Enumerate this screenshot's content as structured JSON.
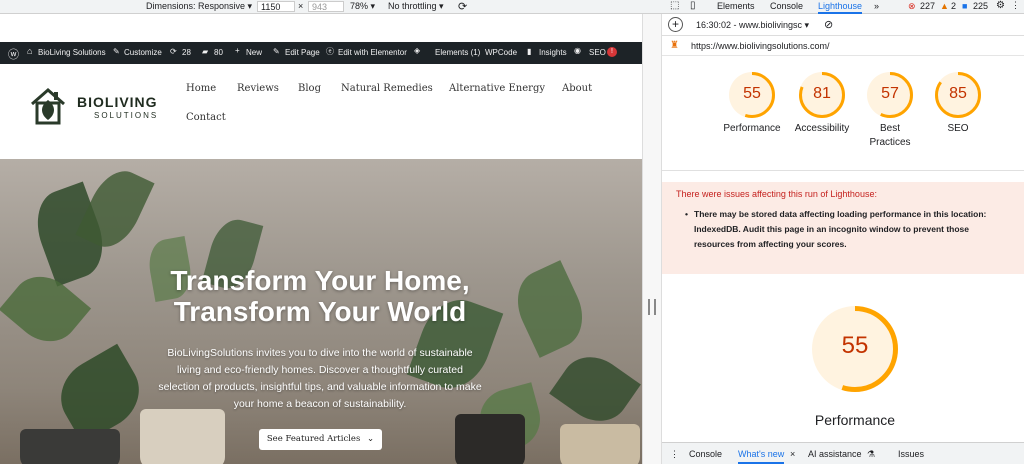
{
  "devtools_toolbar": {
    "dimensions_label": "Dimensions: Responsive ▾",
    "width": "1150",
    "times": "×",
    "height": "943",
    "zoom": "78% ▾",
    "throttling": "No throttling ▾"
  },
  "devtools_tabs": {
    "elements": "Elements",
    "console": "Console",
    "lighthouse": "Lighthouse",
    "more": "»",
    "errors": "227",
    "warnings": "2",
    "issues": "225"
  },
  "wp_admin_bar": {
    "site": "BioLiving Solutions",
    "customize": "Customize",
    "updates": "28",
    "comments": "80",
    "new": "New",
    "edit_page": "Edit Page",
    "elementor": "Edit with Elementor",
    "elements": "Elements (1)",
    "wpcode": "WPCode",
    "insights": "Insights",
    "seo": "SEO"
  },
  "site": {
    "logo_main": "BIOLIVING",
    "logo_sub": "SOLUTIONS",
    "nav": [
      "Home",
      "Reviews",
      "Blog",
      "Natural Remedies",
      "Alternative Energy",
      "About",
      "Contact"
    ]
  },
  "hero": {
    "title_line1": "Transform Your Home,",
    "title_line2": "Transform Your World",
    "text_line1": "BioLivingSolutions invites you to dive into the world of sustainable",
    "text_line2": "living and eco-friendly homes. Discover a thoughtfully curated",
    "text_line3": "selection of products, insightful tips, and valuable information to make",
    "text_line4": "your home a beacon of sustainability.",
    "cta": "See Featured Articles"
  },
  "lighthouse": {
    "timestamp": "16:30:02 - www.biolivingsc ▾",
    "url": "https://www.biolivingsolutions.com/",
    "scores": [
      {
        "label_1": "Performance",
        "label_2": "",
        "value": "55"
      },
      {
        "label_1": "Accessibility",
        "label_2": "",
        "value": "81"
      },
      {
        "label_1": "Best",
        "label_2": "Practices",
        "value": "57"
      },
      {
        "label_1": "SEO",
        "label_2": "",
        "value": "85"
      }
    ],
    "score_fractions": [
      0.55,
      0.81,
      0.57,
      0.85
    ],
    "warning_title": "There were issues affecting this run of Lighthouse:",
    "warning_line1": "There may be stored data affecting loading performance in this location:",
    "warning_line2": "IndexedDB. Audit this page in an incognito window to prevent those",
    "warning_line3": "resources from affecting your scores.",
    "big_score": "55",
    "big_score_fraction": 0.55,
    "big_label": "Performance"
  },
  "drawer_tabs": {
    "console": "Console",
    "whats_new": "What's new",
    "close": "×",
    "ai": "AI assistance",
    "issues": "Issues"
  },
  "colors": {
    "score_orange": "#ffa400",
    "score_text": "#c33300",
    "score_bg": "#fff3e0",
    "tab_blue": "#1a73e8",
    "warn_red": "#c5221f"
  }
}
